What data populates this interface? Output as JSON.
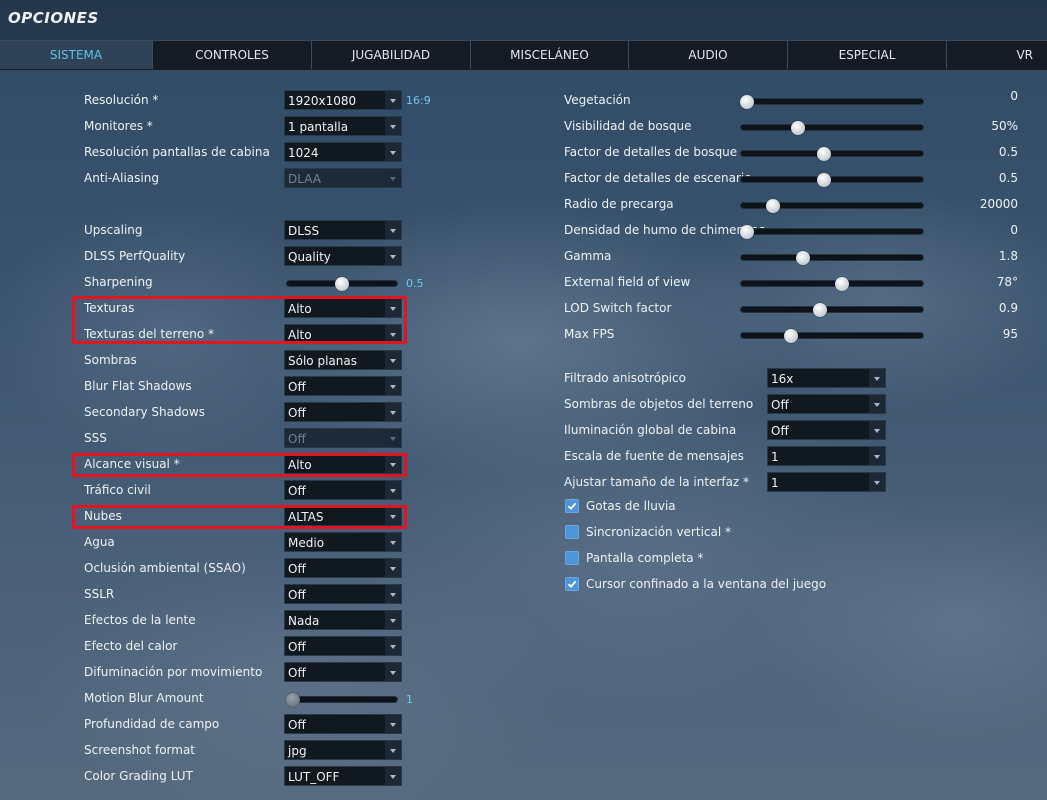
{
  "header": {
    "title": "OPCIONES"
  },
  "tabs": [
    {
      "label": "SISTEMA",
      "active": true
    },
    {
      "label": "CONTROLES"
    },
    {
      "label": "JUGABILIDAD"
    },
    {
      "label": "MISCELÁNEO"
    },
    {
      "label": "AUDIO"
    },
    {
      "label": "ESPECIAL"
    },
    {
      "label": "VR"
    }
  ],
  "left": {
    "resolucion": {
      "label": "Resolución *",
      "value": "1920x1080",
      "aspect": "16:9"
    },
    "monitores": {
      "label": "Monitores *",
      "value": "1 pantalla"
    },
    "res_cabina": {
      "label": "Resolución pantallas de cabina",
      "value": "1024"
    },
    "anti_aliasing": {
      "label": "Anti-Aliasing",
      "value": "DLAA",
      "disabled": true
    },
    "upscaling": {
      "label": "Upscaling",
      "value": "DLSS"
    },
    "dlss_perf": {
      "label": "DLSS PerfQuality",
      "value": "Quality"
    },
    "sharpening": {
      "label": "Sharpening",
      "value": 0.5,
      "value_text": "0.5"
    },
    "texturas": {
      "label": "Texturas",
      "value": "Alto"
    },
    "texturas_terreno": {
      "label": "Texturas del terreno *",
      "value": "Alto"
    },
    "sombras": {
      "label": "Sombras",
      "value": "Sólo planas"
    },
    "blur_flat": {
      "label": "Blur Flat Shadows",
      "value": "Off"
    },
    "secondary_shadows": {
      "label": "Secondary Shadows",
      "value": "Off"
    },
    "sss": {
      "label": "SSS",
      "value": "Off",
      "disabled": true
    },
    "alcance_visual": {
      "label": "Alcance visual *",
      "value": "Alto"
    },
    "trafico_civil": {
      "label": "Tráfico civil",
      "value": "Off"
    },
    "nubes": {
      "label": "Nubes",
      "value": "ALTAS"
    },
    "agua": {
      "label": "Agua",
      "value": "Medio"
    },
    "ssao": {
      "label": "Oclusión ambiental (SSAO)",
      "value": "Off"
    },
    "sslr": {
      "label": "SSLR",
      "value": "Off"
    },
    "efectos_lente": {
      "label": "Efectos de la lente",
      "value": "Nada"
    },
    "efecto_calor": {
      "label": "Efecto del calor",
      "value": "Off"
    },
    "difuminacion": {
      "label": "Difuminación por movimiento",
      "value": "Off"
    },
    "motion_blur": {
      "label": "Motion Blur Amount",
      "value": 1,
      "value_text": "1",
      "fraction": 0
    },
    "profundidad": {
      "label": "Profundidad de campo",
      "value": "Off"
    },
    "screenshot_format": {
      "label": "Screenshot format",
      "value": "jpg"
    },
    "color_grading": {
      "label": "Color Grading LUT",
      "value": "LUT_OFF"
    }
  },
  "right_sliders": [
    {
      "label": "Vegetación",
      "value_text": "0",
      "fraction": 0.0
    },
    {
      "label": "Visibilidad de bosque",
      "value_text": "50%",
      "fraction": 0.3
    },
    {
      "label": "Factor de detalles de bosque",
      "value_text": "0.5",
      "fraction": 0.45
    },
    {
      "label": "Factor de detalles de escenario",
      "value_text": "0.5",
      "fraction": 0.45
    },
    {
      "label": "Radio de precarga",
      "value_text": "20000",
      "fraction": 0.15
    },
    {
      "label": "Densidad de humo de chimeneas",
      "value_text": "0",
      "fraction": 0.0
    },
    {
      "label": "Gamma",
      "value_text": "1.8",
      "fraction": 0.33
    },
    {
      "label": "External field of view",
      "value_text": "78°",
      "fraction": 0.56
    },
    {
      "label": "LOD Switch factor",
      "value_text": "0.9",
      "fraction": 0.43
    },
    {
      "label": "Max FPS",
      "value_text": "95",
      "fraction": 0.26
    }
  ],
  "right_selects": {
    "filtrado": {
      "label": "Filtrado anisotrópico",
      "value": "16x"
    },
    "sombras_objetos": {
      "label": "Sombras de objetos del terreno",
      "value": "Off"
    },
    "iluminacion_cabina": {
      "label": "Iluminación global de cabina",
      "value": "Off"
    },
    "escala_fuente": {
      "label": "Escala de fuente de mensajes",
      "value": "1"
    },
    "tamano_interfaz": {
      "label": "Ajustar tamaño de la interfaz *",
      "value": "1"
    }
  },
  "checkboxes": {
    "gotas": {
      "label": "Gotas de lluvia",
      "checked": true
    },
    "vsync": {
      "label": "Sincronización vertical *",
      "checked": false
    },
    "pantalla_completa": {
      "label": "Pantalla completa *",
      "checked": false
    },
    "cursor": {
      "label": "Cursor confinado a la ventana del juego",
      "checked": true
    }
  },
  "colors": {
    "accent": "#5fc3e8",
    "highlight": "#e3141f",
    "checkbox": "#4f94d6"
  }
}
